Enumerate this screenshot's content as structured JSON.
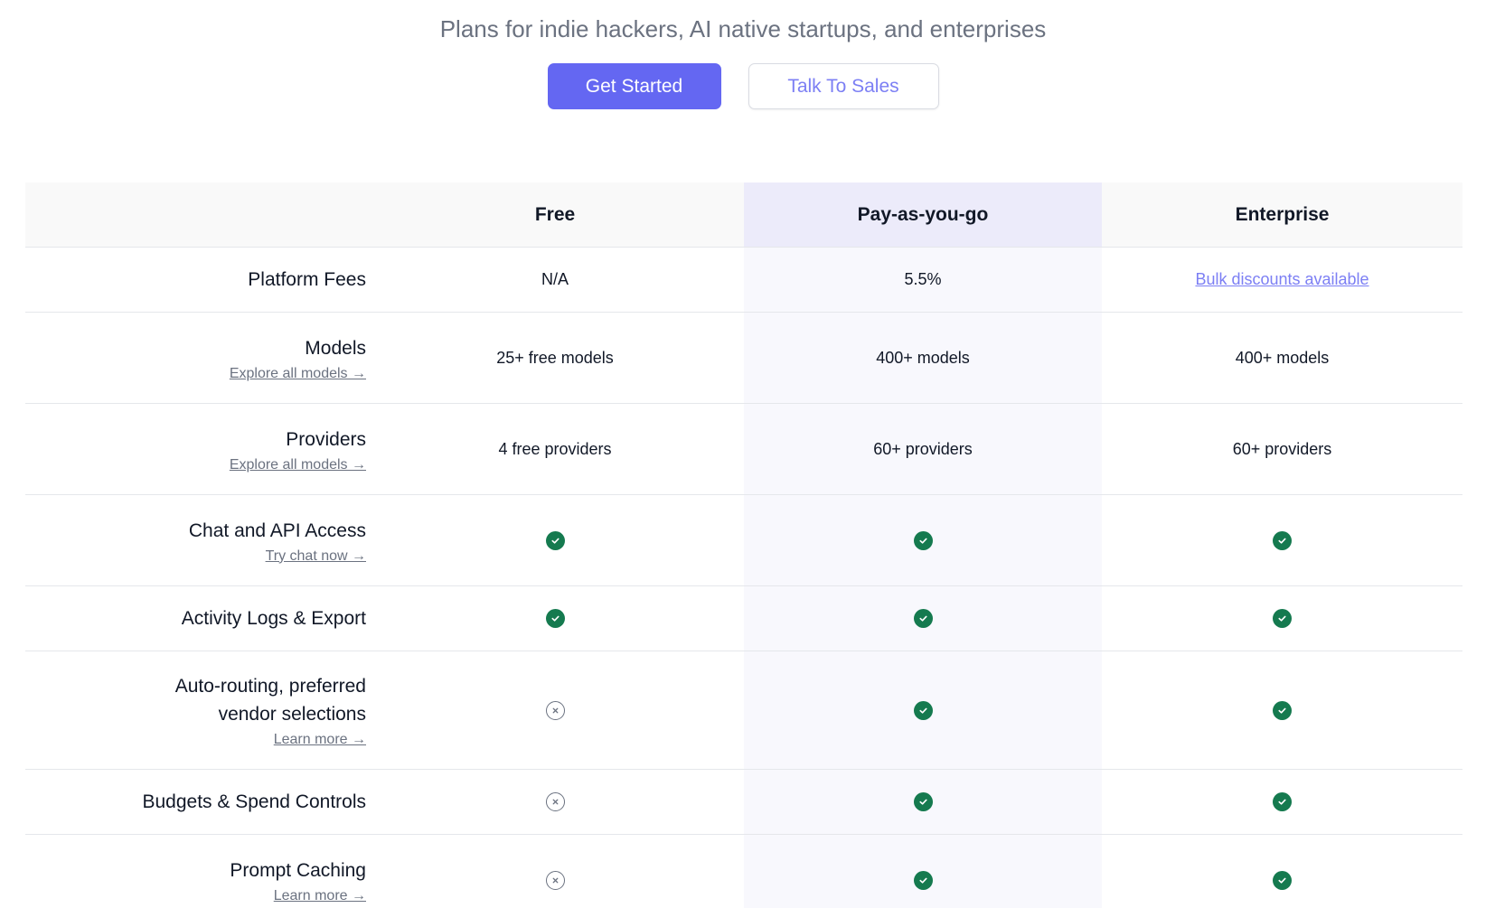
{
  "header": {
    "subtitle": "Plans for indie hackers, AI native startups, and enterprises",
    "get_started_label": "Get Started",
    "talk_to_sales_label": "Talk To Sales"
  },
  "colors": {
    "primary": "#6467f2",
    "link": "#7c7ff4",
    "check": "#157a4f",
    "highlight_column": "#f8f8fd",
    "highlight_header": "#ecebfa"
  },
  "table": {
    "columns": [
      "Free",
      "Pay-as-you-go",
      "Enterprise"
    ],
    "rows": [
      {
        "title": "Platform Fees",
        "link": "",
        "free": "N/A",
        "payg": "5.5%",
        "enterprise": "Bulk discounts available"
      },
      {
        "title": "Models",
        "link": "Explore all models →",
        "free": "25+ free models",
        "payg": "400+ models",
        "enterprise": "400+ models"
      },
      {
        "title": "Providers",
        "link": "Explore all models →",
        "free": "4 free providers",
        "payg": "60+ providers",
        "enterprise": "60+ providers"
      },
      {
        "title": "Chat and API Access",
        "link": "Try chat now →",
        "free": "check-icon",
        "payg": "check-icon",
        "enterprise": "check-icon"
      },
      {
        "title": "Activity Logs & Export",
        "link": "",
        "free": "check-icon",
        "payg": "check-icon",
        "enterprise": "check-icon"
      },
      {
        "title_line1": "Auto-routing, preferred",
        "title_line2": "vendor selections",
        "link": "Learn more →",
        "free": "x-circle-icon",
        "payg": "check-icon",
        "enterprise": "check-icon"
      },
      {
        "title": "Budgets & Spend Controls",
        "link": "",
        "free": "x-circle-icon",
        "payg": "check-icon",
        "enterprise": "check-icon"
      },
      {
        "title": "Prompt Caching",
        "link": "Learn more →",
        "free": "x-circle-icon",
        "payg": "check-icon",
        "enterprise": "check-icon"
      }
    ]
  }
}
